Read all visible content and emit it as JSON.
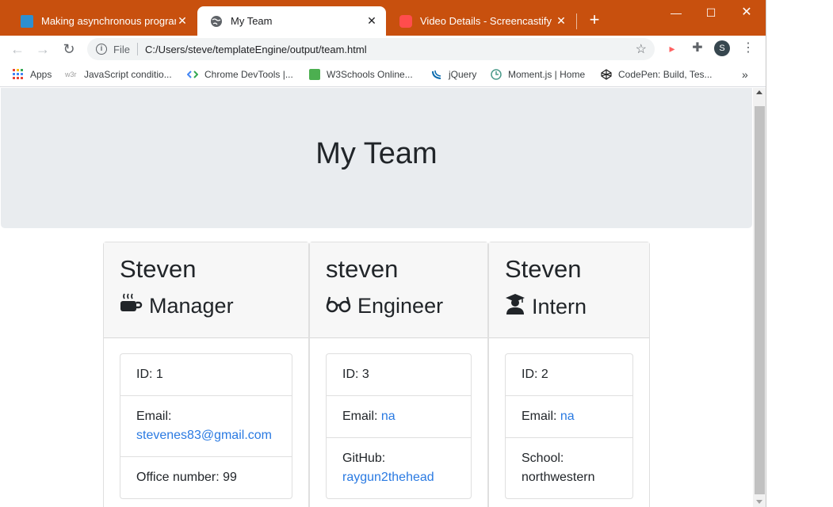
{
  "tabs": [
    {
      "title": "Making asynchronous programm",
      "icon": "github-avatar-icon"
    },
    {
      "title": "My Team",
      "icon": "globe-icon"
    },
    {
      "title": "Video Details - Screencastify",
      "icon": "screencastify-icon"
    }
  ],
  "address": {
    "scheme": "File",
    "url": "C:/Users/steve/templateEngine/output/team.html"
  },
  "profile_initial": "S",
  "bookmarks": [
    {
      "label": "Apps",
      "color": "#ea4335"
    },
    {
      "label": "JavaScript conditio...",
      "color": "#9e9e9e"
    },
    {
      "label": "Chrome DevTools  |...",
      "color": "#4285f4"
    },
    {
      "label": "W3Schools Online...",
      "color": "#4caf50"
    },
    {
      "label": "jQuery",
      "color": "#0769ad"
    },
    {
      "label": "Moment.js | Home",
      "color": "#4a9a8a"
    },
    {
      "label": "CodePen: Build, Tes...",
      "color": "#222222"
    }
  ],
  "page": {
    "title": "My Team"
  },
  "cards": [
    {
      "name": "Steven",
      "role": "Manager",
      "icon": "coffee-icon",
      "rows": [
        {
          "label": "ID: 1",
          "value": ""
        },
        {
          "label": "Email:",
          "value": "stevenes83@gmail.com"
        },
        {
          "label": "Office number: 99",
          "value": ""
        }
      ]
    },
    {
      "name": "steven",
      "role": "Engineer",
      "icon": "glasses-icon",
      "rows": [
        {
          "label": "ID: 3",
          "value": ""
        },
        {
          "label": "Email: ",
          "value": "na"
        },
        {
          "label": "GitHub:",
          "value": "raygun2thehead"
        }
      ]
    },
    {
      "name": "Steven",
      "role": "Intern",
      "icon": "graduate-icon",
      "rows": [
        {
          "label": "ID: 2",
          "value": ""
        },
        {
          "label": "Email: ",
          "value": "na"
        },
        {
          "label": "School:",
          "value": "northwestern"
        }
      ]
    }
  ],
  "colors": {
    "titlebar": "#c8500e",
    "link": "#2a7ae2",
    "jumbotron": "#e9ecef"
  }
}
